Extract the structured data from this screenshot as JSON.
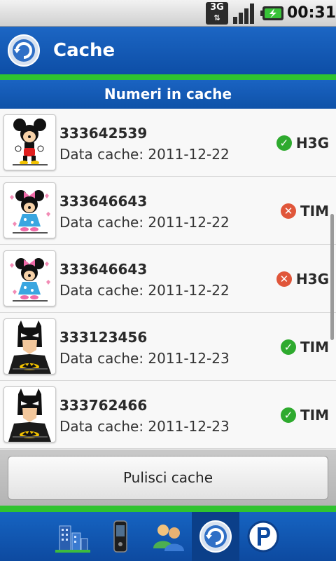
{
  "status_bar": {
    "network": "3G",
    "time": "00:31"
  },
  "header": {
    "title": "Cache"
  },
  "section": {
    "title": "Numeri in cache"
  },
  "cache_list": [
    {
      "number": "333642539",
      "date": "Data cache: 2011-12-22",
      "status": "ok",
      "carrier": "H3G",
      "avatar": "mickey"
    },
    {
      "number": "333646643",
      "date": "Data cache: 2011-12-22",
      "status": "error",
      "carrier": "TIM",
      "avatar": "minnie"
    },
    {
      "number": "333646643",
      "date": "Data cache: 2011-12-22",
      "status": "error",
      "carrier": "H3G",
      "avatar": "minnie"
    },
    {
      "number": "333123456",
      "date": "Data cache: 2011-12-23",
      "status": "ok",
      "carrier": "TIM",
      "avatar": "batman"
    },
    {
      "number": "333762466",
      "date": "Data cache: 2011-12-23",
      "status": "ok",
      "carrier": "TIM",
      "avatar": "batman"
    }
  ],
  "actions": {
    "clear_label": "Pulisci cache"
  },
  "tabs": [
    {
      "name": "buildings-icon",
      "active": false
    },
    {
      "name": "phone-icon",
      "active": false
    },
    {
      "name": "contacts-icon",
      "active": false
    },
    {
      "name": "cache-icon",
      "active": true
    },
    {
      "name": "p-logo-icon",
      "active": false
    }
  ],
  "colors": {
    "primary_blue": "#1664c2",
    "accent_green": "#2fc32f",
    "ok_green": "#2eaa2e",
    "error_red": "#e0563a"
  }
}
